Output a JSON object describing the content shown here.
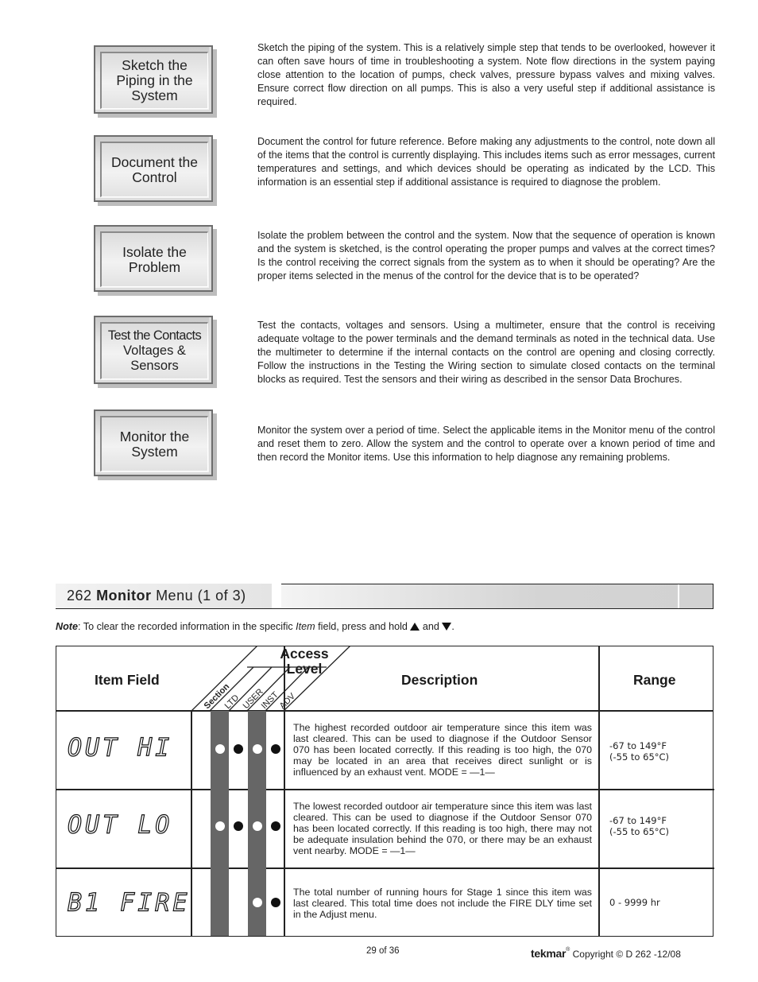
{
  "steps": [
    {
      "label_lines": [
        "Sketch the",
        "Piping in the",
        "System"
      ],
      "text": "Sketch the piping of the system. This is a relatively simple step that tends to be overlooked, however it can often save hours of time in troubleshooting a system. Note flow directions in the system paying close attention to the location of pumps, check valves, pressure bypass valves and mixing valves. Ensure correct flow direction on all pumps. This is also a very useful step if additional assistance is required."
    },
    {
      "label_lines": [
        "Document the",
        "Control"
      ],
      "text": "Document the control for future reference. Before making any adjustments to the control, note down all of the items that the control is currently displaying. This includes items such as error messages, current temperatures and settings, and which devices should be operating as indicated by the LCD. This information is an essential step if additional assistance is required to diagnose the problem."
    },
    {
      "label_lines": [
        "Isolate the",
        "Problem"
      ],
      "text": "Isolate the problem between the control and the system. Now that the sequence of operation is known and the system is sketched, is the control operating the proper pumps and valves at the correct times? Is the control receiving the correct signals from the system as to when it should be operating? Are the proper items selected in the menus of the control for the device that is to be operated?"
    },
    {
      "label_lines": [
        "Test the Contacts",
        "Voltages &",
        "Sensors"
      ],
      "text": "Test the contacts, voltages and sensors. Using a multimeter, ensure that the control is receiving adequate voltage to the power terminals and the demand terminals as noted in the technical data. Use the multimeter to determine if the internal contacts on the control are opening and closing correctly. Follow the instructions in the Testing the Wiring section to simulate closed contacts on the terminal blocks as required. Test the sensors and their wiring as described in the sensor Data Brochures."
    },
    {
      "label_lines": [
        "Monitor the",
        "System"
      ],
      "text": "Monitor the system over a period of time. Select the applicable items in the Monitor menu of the control and reset them to zero. Allow the system and the control to operate over a known period of time and then record the Monitor items. Use this information to help diagnose any remaining problems."
    }
  ],
  "menu": {
    "number": "262",
    "name": "Monitor",
    "suffix": "Menu (1 of 3)"
  },
  "note": {
    "label": "Note",
    "text_before": ": To clear the recorded information in the specific ",
    "italic": "Item",
    "text_after": " field, press and hold ",
    "and": " and ",
    "end": ".",
    "up_icon": "up-arrow-icon",
    "down_icon": "down-arrow-icon"
  },
  "table": {
    "headers": {
      "item_field": "Item Field",
      "access_level_line1": "Access",
      "access_level_line2": "Level",
      "description": "Description",
      "range": "Range"
    },
    "access_columns": [
      "Section",
      "LTD",
      "USER",
      "INST",
      "ADV"
    ],
    "rows": [
      {
        "item": "OUT HI",
        "access": {
          "LTD": "white",
          "USER": "black",
          "INST": "white",
          "ADV": "black"
        },
        "description": "The highest recorded outdoor air temperature since this item was last cleared. This can be used to diagnose if the Outdoor Sensor 070 has been located correctly. If this reading is too high, the 070 may be located in an area that receives direct sunlight or is influenced by an exhaust vent. MODE = —1—",
        "range_lines": [
          "-67 to 149°F",
          "(-55 to 65°C)"
        ]
      },
      {
        "item": "OUT LO",
        "access": {
          "LTD": "white",
          "USER": "black",
          "INST": "white",
          "ADV": "black"
        },
        "description": "The lowest recorded outdoor air temperature since this item was last cleared. This can be used to diagnose if the Outdoor Sensor 070 has been located correctly. If this reading is too high, there may not be adequate insulation behind the 070, or there may be an exhaust vent nearby. MODE = —1—",
        "range_lines": [
          "-67 to 149°F",
          "(-55 to 65°C)"
        ]
      },
      {
        "item": "B1 FIRE",
        "access": {
          "INST": "white",
          "ADV": "black"
        },
        "description": "The total number of running hours for Stage 1 since this item was last cleared. This total time does not include the FIRE DLY time set in the Adjust menu.",
        "range_lines": [
          "0 - 9999 hr"
        ]
      }
    ]
  },
  "footer": {
    "page": "29 of 36",
    "brand": "tekmar",
    "reg": "®",
    "copyright": " Copyright © D 262 -12/08"
  }
}
